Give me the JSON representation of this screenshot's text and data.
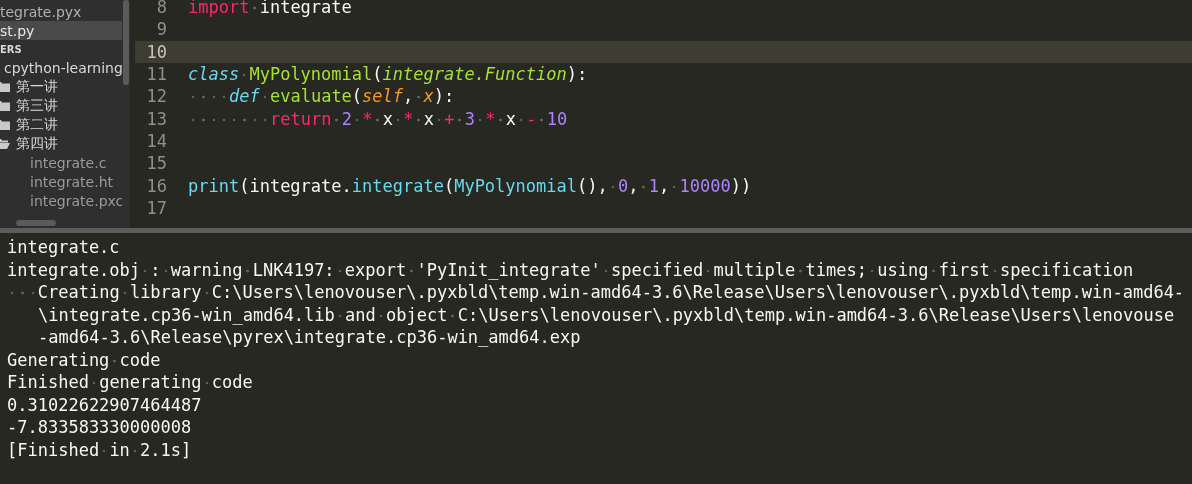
{
  "sidebar": {
    "open_files": [
      {
        "name": "tegrate.pyx",
        "selected": false
      },
      {
        "name": "st.py",
        "selected": true
      }
    ],
    "folders_heading": "ERS",
    "tree": [
      {
        "name": "cpython-learning",
        "children": [
          {
            "name": "第一讲",
            "expanded": false
          },
          {
            "name": "第三讲",
            "expanded": false
          },
          {
            "name": "第二讲",
            "expanded": false
          },
          {
            "name": "第四讲",
            "expanded": true,
            "children": [
              {
                "name": "integrate.c"
              },
              {
                "name": "integrate.ht"
              },
              {
                "name": "integrate.pxc"
              }
            ]
          }
        ]
      }
    ]
  },
  "editor": {
    "lines": [
      {
        "number": "8",
        "current": false,
        "tokens": [
          {
            "kind": "keyword",
            "text": "import"
          },
          {
            "kind": "plain",
            "text": " integrate"
          }
        ]
      },
      {
        "number": "9",
        "current": false
      },
      {
        "number": "10",
        "current": true
      },
      {
        "number": "11",
        "current": false,
        "tokens": [
          {
            "kind": "storage",
            "text": "class "
          },
          {
            "kind": "entity",
            "text": "MyPolynomial"
          },
          {
            "kind": "plain",
            "text": "("
          },
          {
            "kind": "inherited",
            "text": "integrate.Function"
          },
          {
            "kind": "plain",
            "text": "):"
          }
        ]
      },
      {
        "number": "12",
        "current": false,
        "tokens": [
          {
            "kind": "storage",
            "text": "    def "
          },
          {
            "kind": "entity",
            "text": "evaluate"
          },
          {
            "kind": "plain",
            "text": "("
          },
          {
            "kind": "param",
            "text": "self"
          },
          {
            "kind": "plain",
            "text": ", "
          },
          {
            "kind": "param",
            "text": "x"
          },
          {
            "kind": "plain",
            "text": "):"
          }
        ]
      },
      {
        "number": "13",
        "current": false,
        "tokens": [
          {
            "kind": "keyword",
            "text": "        return "
          },
          {
            "kind": "number",
            "text": "2 "
          },
          {
            "kind": "keyword",
            "text": "* "
          },
          {
            "kind": "plain",
            "text": "x "
          },
          {
            "kind": "keyword",
            "text": "* "
          },
          {
            "kind": "plain",
            "text": "x "
          },
          {
            "kind": "keyword",
            "text": "+ "
          },
          {
            "kind": "number",
            "text": "3 "
          },
          {
            "kind": "keyword",
            "text": "* "
          },
          {
            "kind": "plain",
            "text": "x "
          },
          {
            "kind": "keyword",
            "text": "- "
          },
          {
            "kind": "number",
            "text": "10"
          }
        ]
      },
      {
        "number": "14",
        "current": false
      },
      {
        "number": "15",
        "current": false
      },
      {
        "number": "16",
        "current": false,
        "tokens": [
          {
            "kind": "support",
            "text": "print"
          },
          {
            "kind": "plain",
            "text": "(integrate."
          },
          {
            "kind": "support",
            "text": "integrate"
          },
          {
            "kind": "plain",
            "text": "("
          },
          {
            "kind": "support",
            "text": "MyPolynomial"
          },
          {
            "kind": "plain",
            "text": "(), "
          },
          {
            "kind": "number",
            "text": "0"
          },
          {
            "kind": "plain",
            "text": ", "
          },
          {
            "kind": "number",
            "text": "1"
          },
          {
            "kind": "plain",
            "text": ", "
          },
          {
            "kind": "number",
            "text": "10000"
          },
          {
            "kind": "plain",
            "text": "))"
          }
        ]
      },
      {
        "number": "17",
        "current": false
      }
    ]
  },
  "output": {
    "lines": [
      {
        "text": "integrate.c",
        "continuation": false
      },
      {
        "text": "integrate.obj : warning LNK4197: export 'PyInit_integrate' specified multiple times; using first specification",
        "continuation": false
      },
      {
        "text": "   Creating library C:\\Users\\lenovouser\\.pyxbld\\temp.win-amd64-3.6\\Release\\Users\\lenovouser\\.pyxbld\\temp.win-amd64-",
        "continuation": false
      },
      {
        "text": "\\integrate.cp36-win_amd64.lib and object C:\\Users\\lenovouser\\.pyxbld\\temp.win-amd64-3.6\\Release\\Users\\lenovouse",
        "continuation": true
      },
      {
        "text": "-amd64-3.6\\Release\\pyrex\\integrate.cp36-win_amd64.exp",
        "continuation": true
      },
      {
        "text": "Generating code",
        "continuation": false
      },
      {
        "text": "Finished generating code",
        "continuation": false
      },
      {
        "text": "0.31022622907464487",
        "continuation": false
      },
      {
        "text": "-7.833583330000008",
        "continuation": false
      },
      {
        "text": "[Finished in 2.1s]",
        "continuation": false
      }
    ]
  }
}
